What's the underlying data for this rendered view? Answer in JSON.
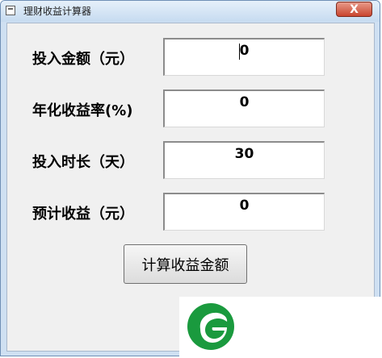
{
  "window": {
    "title": "理财收益计算器",
    "close_symbol": "X"
  },
  "form": {
    "fields": [
      {
        "label": "投入金额（元）",
        "value": "0"
      },
      {
        "label": "年化收益率(%)",
        "value": "0"
      },
      {
        "label": "投入时长（天）",
        "value": "30"
      },
      {
        "label": "预计收益（元）",
        "value": "0"
      }
    ],
    "calculate_label": "计算收益金额"
  },
  "colors": {
    "logo_green": "#1a9a3e",
    "close_red": "#c9452f"
  },
  "icons": {
    "app": "window-app-icon",
    "close": "close-icon",
    "logo": "leaf-logo"
  }
}
